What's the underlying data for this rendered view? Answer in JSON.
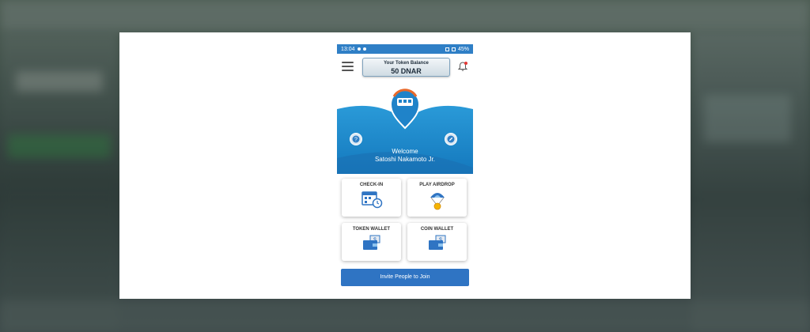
{
  "status_bar": {
    "time": "13:04",
    "battery": "45%"
  },
  "header": {
    "balance_label": "Your Token Balance",
    "balance_value": "50 DNAR"
  },
  "welcome": {
    "greeting": "Welcome",
    "name": "Satoshi Nakamoto Jr."
  },
  "tiles": [
    {
      "label": "CHECK-IN",
      "icon": "calendar-clock-icon"
    },
    {
      "label": "PLAY AIRDROP",
      "icon": "parachute-coin-icon"
    },
    {
      "label": "TOKEN WALLET",
      "icon": "wallet-icon"
    },
    {
      "label": "COIN WALLET",
      "icon": "wallet-icon"
    }
  ],
  "invite_button": "Invite People to Join",
  "colors": {
    "primary": "#2f74c3",
    "hero": "#1f8fd0",
    "accent": "#e8692a"
  }
}
